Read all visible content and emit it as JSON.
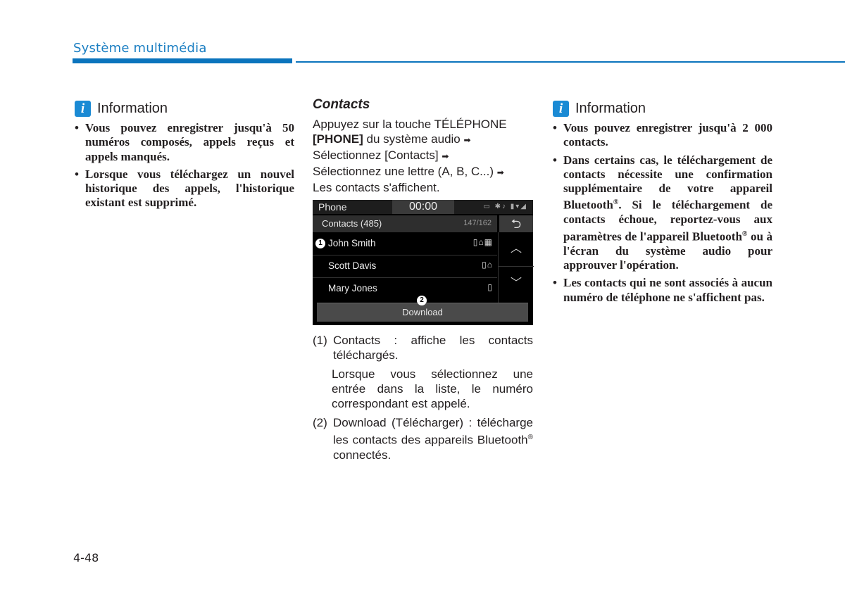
{
  "header": {
    "section_title": "Système multimédia",
    "accent_color": "#0b74bd"
  },
  "left_info": {
    "icon": "info-icon",
    "title": "Information",
    "bullets": [
      "Vous pouvez enregistrer jusqu'à 50 numéros composés, appels reçus et appels manqués.",
      "Lorsque vous téléchargez un nouvel historique des appels, l'historique existant est supprimé."
    ]
  },
  "contacts_section": {
    "title": "Contacts",
    "intro_1": "Appuyez sur la touche TÉLÉPHONE",
    "intro_phone": "[PHONE]",
    "intro_2": " du système audio ",
    "intro_3": "Sélectionnez [Contacts] ",
    "intro_4": "Sélectionnez une lettre (A, B, C...) ",
    "intro_5": "Les contacts s'affichent.",
    "arrow": "➡"
  },
  "screen": {
    "title": "Phone",
    "clock": "00:00",
    "status_icons": "▭ ✱♪ ▮▾◢",
    "list_title": "Contacts (485)",
    "list_count": "147/162",
    "back_icon": "⮌",
    "contacts": [
      {
        "name": "John Smith",
        "icons": "▯⌂▦"
      },
      {
        "name": "Scott Davis",
        "icons": "▯⌂"
      },
      {
        "name": "Mary Jones",
        "icons": "▯"
      }
    ],
    "scroll_up": "︿",
    "scroll_down": "﹀",
    "download_label": "Download",
    "callout_1": "1",
    "callout_2": "2"
  },
  "legend": {
    "item1_num": "(1)",
    "item1_text": "Contacts : affiche les contacts téléchargés.",
    "item1_sub": "Lorsque vous sélectionnez une entrée dans la liste, le numéro correspondant est appelé.",
    "item2_num": "(2)",
    "item2_text_a": "Download (Télécharger) : télécharge les contacts des appareils Bluetooth",
    "item2_reg": "®",
    "item2_text_b": " connectés."
  },
  "right_info": {
    "icon": "info-icon",
    "title": "Information",
    "bullet1": "Vous pouvez enregistrer jusqu'à 2 000 contacts.",
    "bullet2_a": "Dans certains cas, le téléchargement de contacts nécessite une confirmation supplémentaire de votre appareil Bluetooth",
    "bullet2_reg": "®",
    "bullet2_b": ". Si le téléchargement de contacts échoue, reportez-vous aux paramètres de l'appareil Bluetooth",
    "bullet2_reg2": "®",
    "bullet2_c": " ou à l'écran du système audio pour approuver l'opération.",
    "bullet3": "Les contacts qui ne sont associés à aucun numéro de téléphone ne s'affichent pas."
  },
  "footer": {
    "page_number": "4-48"
  }
}
